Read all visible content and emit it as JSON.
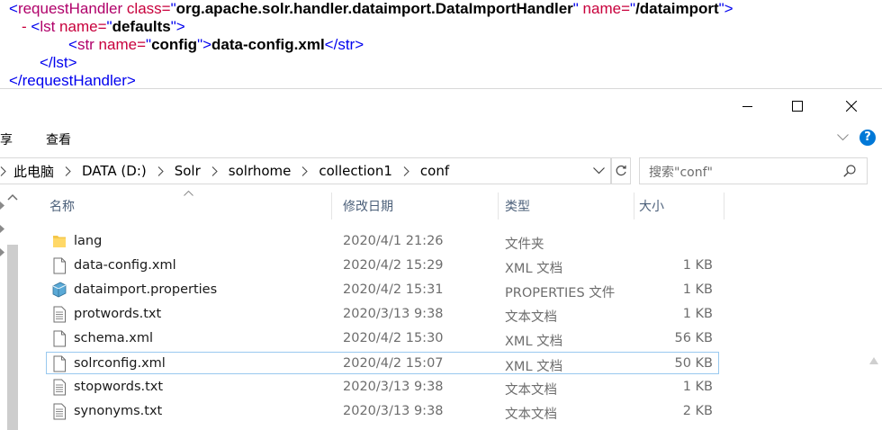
{
  "xml": {
    "line1": {
      "open": "<",
      "tag": "requestHandler",
      "a1": " class=",
      "q": "\"",
      "v1": "org.apache.solr.handler.dataimport.DataImportHandler",
      "a2": " name=",
      "v2": "/dataimport",
      "close": ">"
    },
    "line2": {
      "dash": "- ",
      "open": "<",
      "tag": "lst",
      "a1": " name=",
      "q": "\"",
      "v1": "defaults",
      "close": ">"
    },
    "line3": {
      "open": "<",
      "tag": "str",
      "a1": " name=",
      "q": "\"",
      "v1": "config",
      "close": ">",
      "text": "data-config.xml",
      "endtag": "</str>"
    },
    "line4": {
      "text": "</lst>"
    },
    "line5": {
      "text": "</requestHandler>"
    }
  },
  "window": {
    "ribbon": {
      "share": "享",
      "view": "查看"
    },
    "address": {
      "crumbs": [
        "此电脑",
        "DATA (D:)",
        "Solr",
        "solrhome",
        "collection1",
        "conf"
      ]
    },
    "search": {
      "placeholder": "搜索\"conf\""
    },
    "columns": {
      "name": "名称",
      "date": "修改日期",
      "type": "类型",
      "size": "大小"
    },
    "files": [
      {
        "name": "lang",
        "date": "2020/4/1 21:26",
        "type": "文件夹",
        "size": "",
        "icon": "folder-icon"
      },
      {
        "name": "data-config.xml",
        "date": "2020/4/2 15:29",
        "type": "XML 文档",
        "size": "1 KB",
        "icon": "file-icon"
      },
      {
        "name": "dataimport.properties",
        "date": "2020/4/2 15:31",
        "type": "PROPERTIES 文件",
        "size": "1 KB",
        "icon": "properties-icon"
      },
      {
        "name": "protwords.txt",
        "date": "2020/3/13 9:38",
        "type": "文本文档",
        "size": "1 KB",
        "icon": "text-file-icon"
      },
      {
        "name": "schema.xml",
        "date": "2020/4/2 15:30",
        "type": "XML 文档",
        "size": "56 KB",
        "icon": "file-icon"
      },
      {
        "name": "solrconfig.xml",
        "date": "2020/4/2 15:07",
        "type": "XML 文档",
        "size": "50 KB",
        "icon": "file-icon"
      },
      {
        "name": "stopwords.txt",
        "date": "2020/3/13 9:38",
        "type": "文本文档",
        "size": "1 KB",
        "icon": "text-file-icon"
      },
      {
        "name": "synonyms.txt",
        "date": "2020/3/13 9:38",
        "type": "文本文档",
        "size": "2 KB",
        "icon": "text-file-icon"
      }
    ],
    "selected_row": "solrconfig.xml",
    "colors": {
      "accent": "#0078d7",
      "selection_border": "#99c9ef"
    }
  }
}
